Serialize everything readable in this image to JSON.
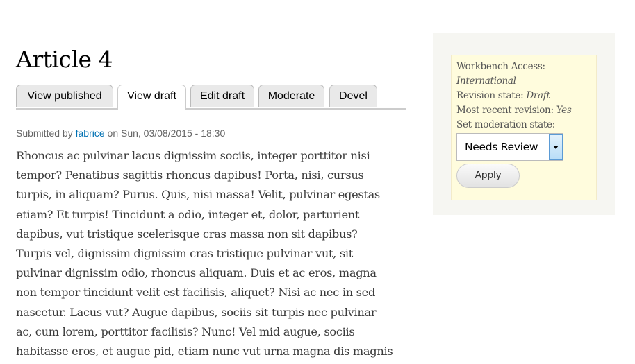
{
  "title": "Article 4",
  "tabs": [
    {
      "label": "View published",
      "active": false
    },
    {
      "label": "View draft",
      "active": true
    },
    {
      "label": "Edit draft",
      "active": false
    },
    {
      "label": "Moderate",
      "active": false
    },
    {
      "label": "Devel",
      "active": false
    }
  ],
  "meta": {
    "prefix": "Submitted by",
    "author": "fabrice",
    "suffix": "on Sun, 03/08/2015 - 18:30"
  },
  "body_lines": [
    "Rhoncus ac pulvinar lacus dignissim sociis, integer porttitor nisi",
    "tempor? Penatibus sagittis rhoncus dapibus! Porta, nisi, cursus",
    "turpis, in aliquam? Purus. Quis, nisi massa! Velit, pulvinar egestas",
    "etiam? Et turpis! Tincidunt a odio, integer et, dolor, parturient",
    "dapibus, vut tristique scelerisque cras massa non sit dapibus?",
    "Turpis vel, dignissim dignissim cras tristique pulvinar vut, sit",
    "pulvinar dignissim odio, rhoncus aliquam. Duis et ac eros, magna",
    "non tempor tincidunt velit est facilisis, aliquet? Nisi ac nec in sed",
    "nascetur. Lacus vut? Augue dapibus, sociis sit turpis nec pulvinar",
    "ac, cum lorem, porttitor facilisis? Nunc! Vel mid augue, sociis",
    "habitasse eros, et augue pid, etiam nunc vut urna magna dis magnis"
  ],
  "moderation": {
    "access_label": "Workbench Access:",
    "access_value": "International",
    "state_label": "Revision state:",
    "state_value": "Draft",
    "recent_label": "Most recent revision:",
    "recent_value": "Yes",
    "set_label": "Set moderation state:",
    "select_value": "Needs Review",
    "apply_label": "Apply"
  }
}
